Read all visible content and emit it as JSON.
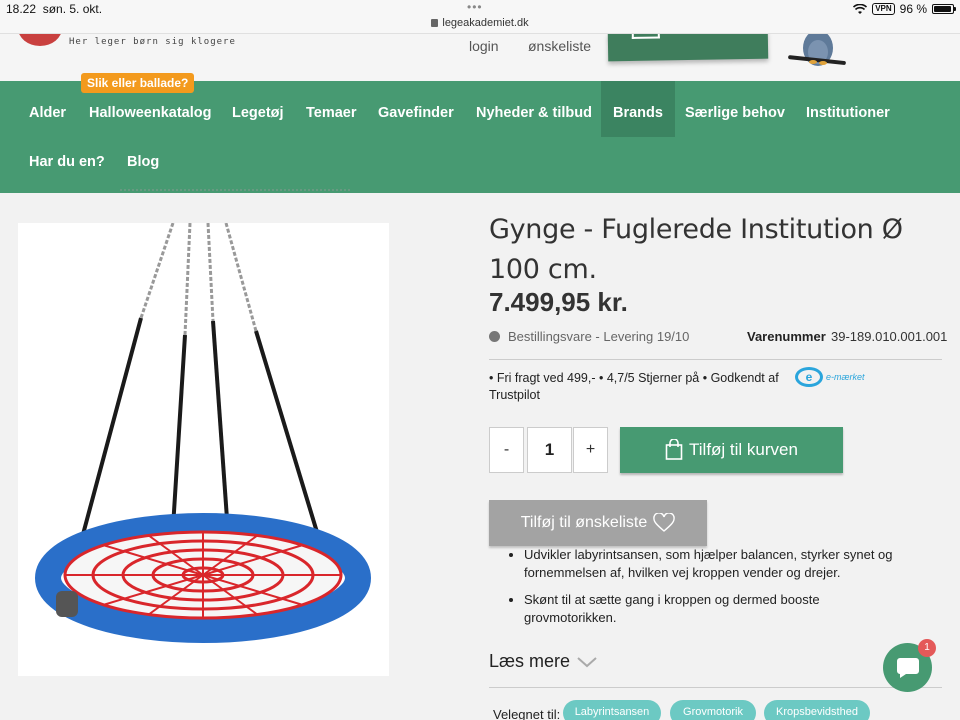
{
  "status_bar": {
    "time": "18.22",
    "date": "søn. 5. okt.",
    "url": "legeakademiet.dk",
    "vpn": "VPN",
    "battery": "96 %",
    "battery_level": 0.96
  },
  "header": {
    "tagline": "Her leger børn sig klogere",
    "login": "login",
    "wishlist": "ønskeliste"
  },
  "promo_badge": "Slik eller ballade?",
  "nav": {
    "items": [
      "Alder",
      "Halloweenkatalog",
      "Legetøj",
      "Temaer",
      "Gavefinder",
      "Nyheder & tilbud",
      "Brands",
      "Særlige behov",
      "Institutioner",
      "Har du en?",
      "Blog"
    ],
    "active": "Brands"
  },
  "product": {
    "title": "Gynge - Fuglerede Institution Ø 100 cm.",
    "price": "7.499,95  kr.",
    "availability": "Bestillingsvare - Levering 19/10",
    "item_number_label": "Varenummer",
    "item_number": "39-189.010.001.001",
    "usp_text": "• Fri fragt ved 499,-  •  4,7/5 Stjerner på   • Godkendt af",
    "usp_trustpilot": "Trustpilot",
    "emark_letter": "e",
    "emark_text": "e-mærket",
    "qty_minus": "-",
    "qty_value": "1",
    "qty_plus": "+",
    "add_to_cart": "Tilføj til kurven",
    "add_to_wishlist": "Tilføj til ønskeliste",
    "bullets": [
      "Udvikler labyrintsansen, som hjælper balancen, styrker synet og fornemmelsen af, hvilken vej kroppen vender og drejer.",
      "Skønt til at sætte gang i kroppen og dermed booste grovmotorikken."
    ],
    "read_more": "Læs mere",
    "suited_for_label": "Velegnet til:",
    "tags": [
      "Labyrintsansen",
      "Grovmotorik",
      "Kropsbevidsthed"
    ]
  },
  "chat": {
    "badge": "1"
  },
  "colors": {
    "nav_green": "#479a72",
    "nav_active": "#3b8461",
    "promo_orange": "#f39a1d",
    "tag_teal": "#6cc9c3",
    "wishlist_gray": "#a3a3a3"
  }
}
